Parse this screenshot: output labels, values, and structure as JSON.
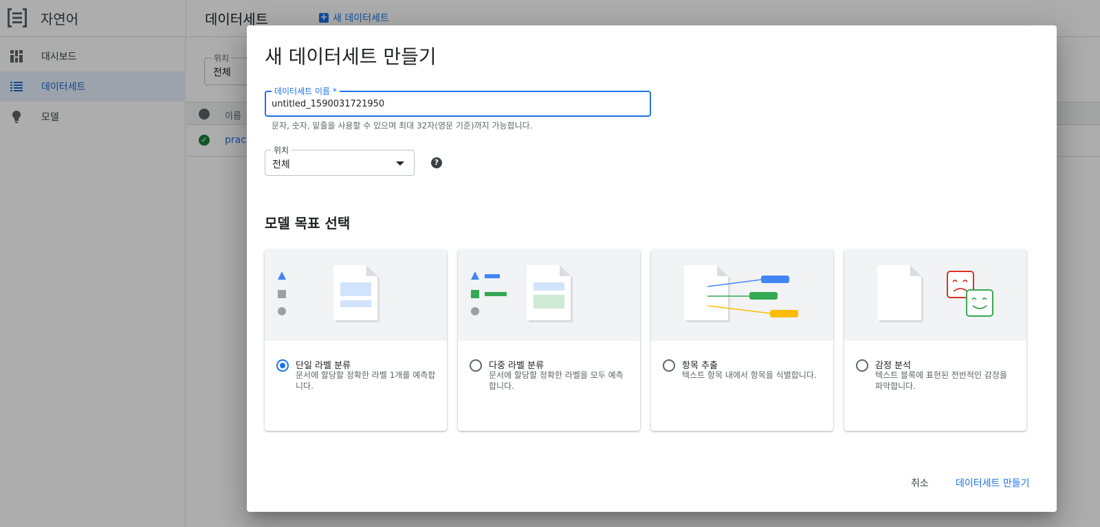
{
  "app": {
    "product_name": "자연어",
    "page_title": "데이터세트",
    "new_dataset_label": "새 데이터세트"
  },
  "sidebar": {
    "items": [
      {
        "label": "대시보드",
        "icon": "dashboard-icon"
      },
      {
        "label": "데이터세트",
        "icon": "list-icon",
        "active": true
      },
      {
        "label": "모델",
        "icon": "lightbulb-icon"
      }
    ]
  },
  "background": {
    "filter_label": "위치",
    "filter_value": "전체",
    "table_header_name": "이름",
    "row_name": "pract"
  },
  "dialog": {
    "title": "새 데이터세트 만들기",
    "name_field": {
      "label": "데이터세트 이름 *",
      "value": "untitled_1590031721950",
      "hint": "문자, 숫자, 밑줄을 사용할 수 있으며 최대 32자(영문 기준)까지 가능합니다."
    },
    "location_field": {
      "label": "위치",
      "value": "전체"
    },
    "section_title": "모델 목표 선택",
    "objectives": [
      {
        "title": "단일 라벨 분류",
        "description": "문서에 할당할 정확한 라벨 1개를 예측합니다.",
        "selected": true
      },
      {
        "title": "다중 라벨 분류",
        "description": "문서에 할당할 정확한 라벨을 모두 예측합니다.",
        "selected": false
      },
      {
        "title": "항목 추출",
        "description": "텍스트 항목 내에서 항목을 식별합니다.",
        "selected": false
      },
      {
        "title": "감정 분석",
        "description": "텍스트 블록에 표현된 전반적인 감정을 파악합니다.",
        "selected": false
      }
    ],
    "cancel_label": "취소",
    "create_label": "데이터세트 만들기"
  },
  "colors": {
    "accent": "#1a73e8",
    "green": "#34a853",
    "yellow": "#fbbc04",
    "red": "#d93025"
  }
}
